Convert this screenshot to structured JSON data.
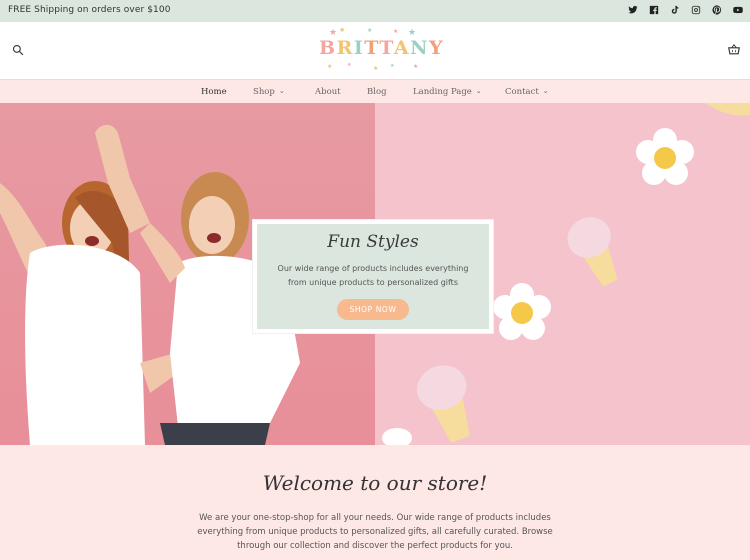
{
  "announcement": {
    "text": "FREE Shipping on orders over $100"
  },
  "social": [
    "twitter-icon",
    "facebook-icon",
    "tiktok-icon",
    "instagram-icon",
    "pinterest-icon",
    "youtube-icon"
  ],
  "header": {
    "logo_text": [
      "B",
      "R",
      "I",
      "T",
      "T",
      "A",
      "N",
      "Y"
    ]
  },
  "nav": {
    "items": [
      {
        "label": "Home",
        "active": true
      },
      {
        "label": "Shop",
        "dropdown": true
      },
      {
        "label": "About"
      },
      {
        "label": "Blog"
      },
      {
        "label": "Landing Page",
        "dropdown": true
      },
      {
        "label": "Contact",
        "dropdown": true
      }
    ]
  },
  "hero": {
    "title": "Fun Styles",
    "text": "Our wide range of products includes everything from unique products to personalized gifts",
    "button": "SHOP NOW"
  },
  "welcome": {
    "title": "Welcome to our store!",
    "text": "We are your one-stop-shop for all your needs. Our wide range of products includes everything from unique products to personalized gifts, all carefully curated. Browse through our collection and discover the perfect products for you."
  },
  "colors": {
    "announcement_bg": "#dbe6df",
    "nav_bg": "#fde8e6",
    "button": "#f8b98f",
    "hero_left": "#e88f99",
    "hero_right": "#f5c3cb"
  }
}
